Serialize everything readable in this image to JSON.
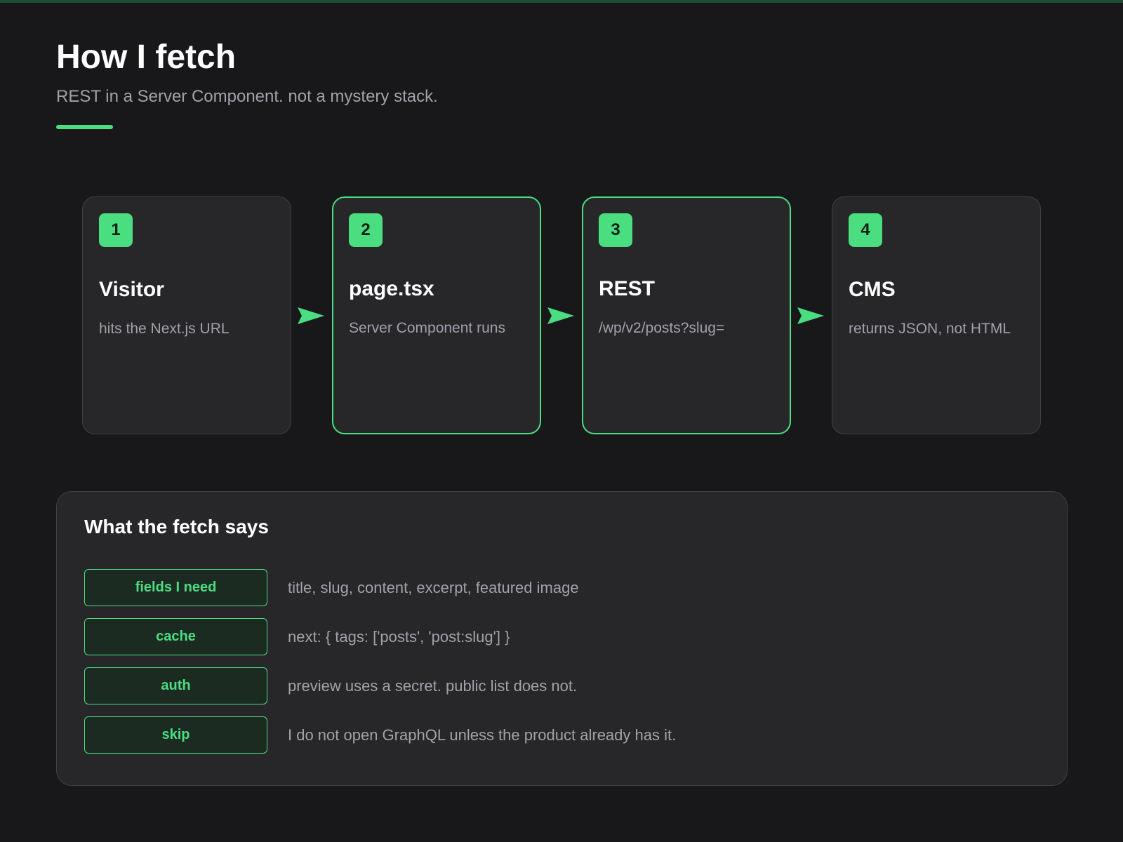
{
  "header": {
    "title": "How I fetch",
    "subtitle": "REST in a Server Component. not a mystery stack."
  },
  "theme": {
    "background": "#18181b",
    "card": "#27272a",
    "accent": "#4ade80",
    "muted_text": "#a1a1aa"
  },
  "steps": [
    {
      "number": "1",
      "title": "Visitor",
      "description": "hits the Next.js URL",
      "highlighted": false
    },
    {
      "number": "2",
      "title": "page.tsx",
      "description": "Server Component runs",
      "highlighted": true
    },
    {
      "number": "3",
      "title": "REST",
      "description": "/wp/v2/posts?slug=",
      "highlighted": true
    },
    {
      "number": "4",
      "title": "CMS",
      "description": "returns JSON, not HTML",
      "highlighted": false
    }
  ],
  "fetch_panel": {
    "title": "What the fetch says",
    "rows": [
      {
        "key": "fields I need",
        "value": "title, slug, content, excerpt, featured image"
      },
      {
        "key": "cache",
        "value": "next: { tags: ['posts', 'post:slug'] }"
      },
      {
        "key": "auth",
        "value": "preview uses a secret. public list does not."
      },
      {
        "key": "skip",
        "value": "I do not open GraphQL unless the product already has it."
      }
    ]
  }
}
